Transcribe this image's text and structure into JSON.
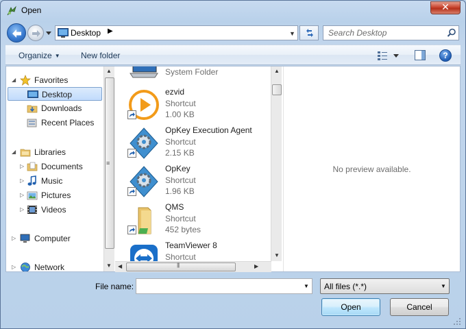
{
  "window": {
    "title": "Open"
  },
  "address_bar": {
    "location": "Desktop",
    "separator": "▶"
  },
  "search": {
    "placeholder": "Search Desktop"
  },
  "toolbar": {
    "organize_label": "Organize",
    "new_folder_label": "New folder",
    "help_label": "?"
  },
  "nav": {
    "favorites": "Favorites",
    "desktop": "Desktop",
    "downloads": "Downloads",
    "recent_places": "Recent Places",
    "libraries": "Libraries",
    "documents": "Documents",
    "music": "Music",
    "pictures": "Pictures",
    "videos": "Videos",
    "computer": "Computer",
    "network": "Network"
  },
  "files": [
    {
      "name": "",
      "type": "System Folder",
      "size": ""
    },
    {
      "name": "ezvid",
      "type": "Shortcut",
      "size": "1.00 KB"
    },
    {
      "name": "OpKey Execution Agent",
      "type": "Shortcut",
      "size": "2.15 KB"
    },
    {
      "name": "OpKey",
      "type": "Shortcut",
      "size": "1.96 KB"
    },
    {
      "name": "QMS",
      "type": "Shortcut",
      "size": "452 bytes"
    },
    {
      "name": "TeamViewer 8",
      "type": "Shortcut",
      "size": ""
    }
  ],
  "preview": {
    "message": "No preview available."
  },
  "footer": {
    "file_name_label": "File name:",
    "file_name_value": "",
    "file_type_filter": "All files (*.*)",
    "open_label": "Open",
    "cancel_label": "Cancel"
  },
  "colors": {
    "accent": "#3c7fb1",
    "selection": "#c1dbfc",
    "close": "#c94530"
  }
}
